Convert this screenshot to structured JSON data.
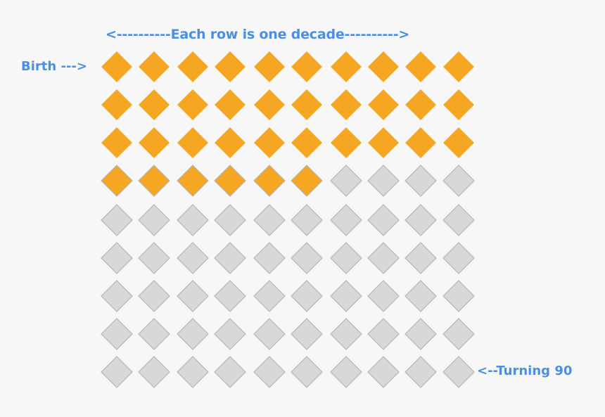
{
  "labels": {
    "top": "<----------Each row is one decade---------->",
    "birth": "Birth --->",
    "end": "<--Turning 90"
  },
  "grid": {
    "rows": 9,
    "columns": 10,
    "filled_count": 36,
    "total_count": 90,
    "unit": "year",
    "row_unit": "decade"
  },
  "colors": {
    "filled": "#f5a623",
    "empty": "#d8d8d8",
    "empty_border": "#b5b5b5",
    "label": "#4a90e2",
    "background": "#f7f7f7"
  }
}
